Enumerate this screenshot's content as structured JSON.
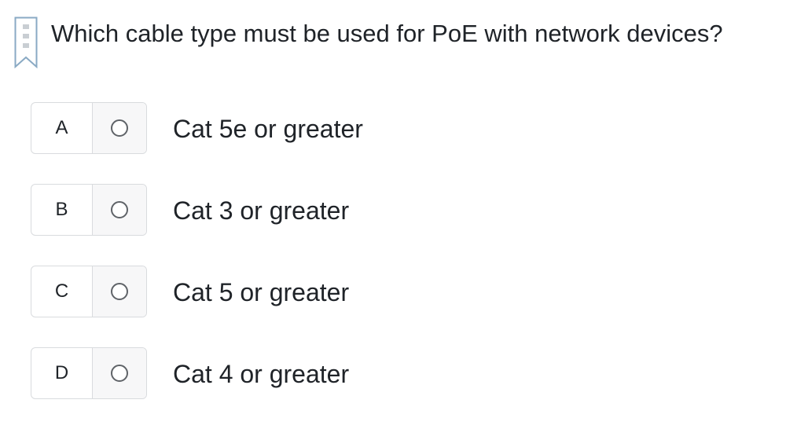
{
  "question": {
    "text": "Which cable type must be used for PoE with network devices?",
    "bookmark_icon": "bookmark-icon"
  },
  "options": [
    {
      "letter": "A",
      "text": "Cat 5e or greater",
      "selected": false
    },
    {
      "letter": "B",
      "text": "Cat 3 or greater",
      "selected": false
    },
    {
      "letter": "C",
      "text": "Cat 5 or greater",
      "selected": false
    },
    {
      "letter": "D",
      "text": "Cat 4 or greater",
      "selected": false
    }
  ],
  "colors": {
    "border": "#d9dbde",
    "bookmark": "#8aaac4",
    "radio_border": "#5f6368",
    "text": "#1f2328"
  }
}
